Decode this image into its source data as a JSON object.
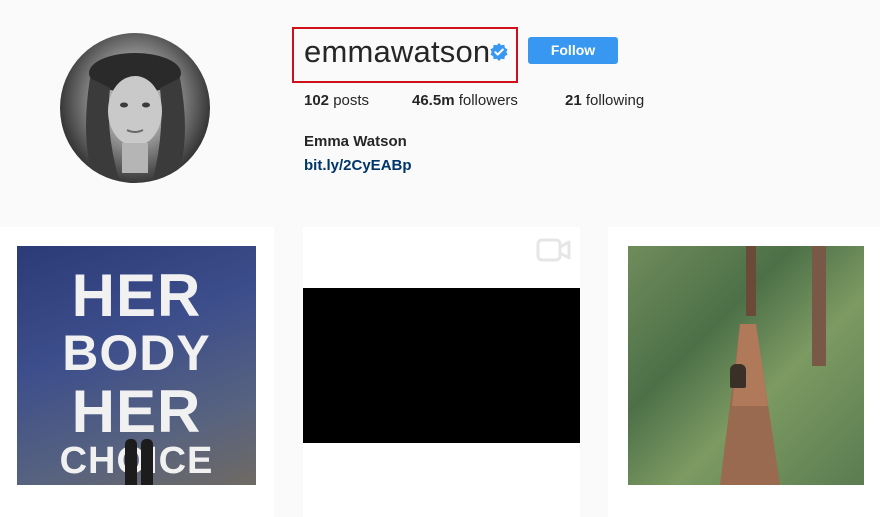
{
  "profile": {
    "username": "emmawatson",
    "follow_label": "Follow",
    "full_name": "Emma Watson",
    "link": "bit.ly/2CyEABp"
  },
  "stats": {
    "posts_count": "102",
    "posts_label": " posts",
    "followers_count": "46.5m",
    "followers_label": " followers",
    "following_count": "21",
    "following_label": " following"
  },
  "posts": [
    {
      "poster_lines": [
        "HER",
        "BODY",
        "HER",
        "CHOICE"
      ]
    }
  ],
  "colors": {
    "follow_button": "#3897f0",
    "highlight_box": "#d0111b",
    "link": "#003569"
  },
  "icons": [
    "verified-badge-icon",
    "video-camera-icon"
  ]
}
